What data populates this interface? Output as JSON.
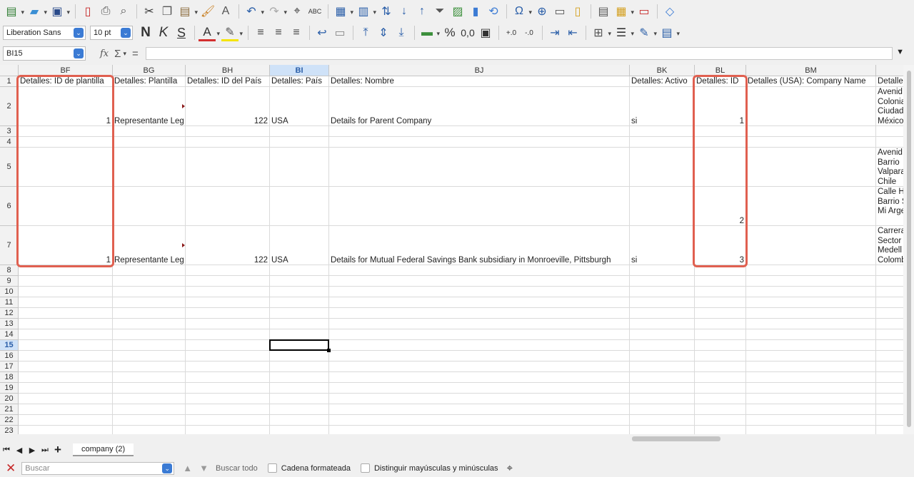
{
  "toolbar": {
    "font_name": "Liberation Sans",
    "font_size": "10 pt",
    "bold_glyph": "N",
    "italic_glyph": "K",
    "underline_glyph": "S",
    "percent_glyph": "%",
    "number_glyph": "0,0"
  },
  "formula_bar": {
    "name_box": "BI15",
    "fx_label": "fx",
    "sum_glyph": "Σ",
    "equals_glyph": "=",
    "content": ""
  },
  "columns": [
    {
      "id": "BF",
      "label": "BF"
    },
    {
      "id": "BG",
      "label": "BG"
    },
    {
      "id": "BH",
      "label": "BH"
    },
    {
      "id": "BI",
      "label": "BI"
    },
    {
      "id": "BJ",
      "label": "BJ"
    },
    {
      "id": "BK",
      "label": "BK"
    },
    {
      "id": "BL",
      "label": "BL"
    },
    {
      "id": "BM",
      "label": "BM"
    },
    {
      "id": "BN",
      "label": ""
    }
  ],
  "rows": [
    "1",
    "2",
    "3",
    "4",
    "5",
    "6",
    "7",
    "8",
    "9",
    "10",
    "11",
    "12",
    "13",
    "14",
    "15",
    "16",
    "17",
    "18",
    "19",
    "20",
    "21",
    "22",
    "23"
  ],
  "headers": {
    "BF": "Detalles: ID de plantilla",
    "BG": "Detalles: Plantilla",
    "BH": "Detalles: ID del País",
    "BI": "Detalles: País",
    "BJ": "Detalles: Nombre",
    "BK": "Detalles: Activo",
    "BL": "Detalles: ID",
    "BM": "Detalles (USA): Company Name",
    "BN": "Detalle"
  },
  "cells": {
    "BF2": "1",
    "BG2": "Representante Leg",
    "BH2": "122",
    "BI2": "USA",
    "BJ2": "Details for Parent Company",
    "BK2": "si",
    "BL2": "1",
    "BN2": "Avenid Colonia Ciudad México",
    "BN5": "Avenid Barrio Valpara Chile",
    "BL6": "2",
    "BN6": "Calle H Barrio San Mi Argent",
    "BF7": "1",
    "BG7": "Representante Leg",
    "BH7": "122",
    "BI7": "USA",
    "BJ7": "Details for Mutual Federal Savings Bank subsidiary in Monroeville, Pittsburgh",
    "BK7": "si",
    "BL7": "3",
    "BN7": "Carrera Sector Medell Colomb"
  },
  "selection": {
    "active_cell": "BI15",
    "active_column": "BI",
    "active_row": "15"
  },
  "sheet_tabs": [
    {
      "label": "company (2)",
      "active": true
    }
  ],
  "find_bar": {
    "placeholder": "Buscar",
    "find_all": "Buscar todo",
    "formatted_string": "Cadena formateada",
    "match_case": "Distinguir mayúsculas y minúsculas"
  },
  "colors": {
    "accent": "#3b7bd4",
    "highlight": "#e06050",
    "selected_header": "#cfe2f8"
  }
}
